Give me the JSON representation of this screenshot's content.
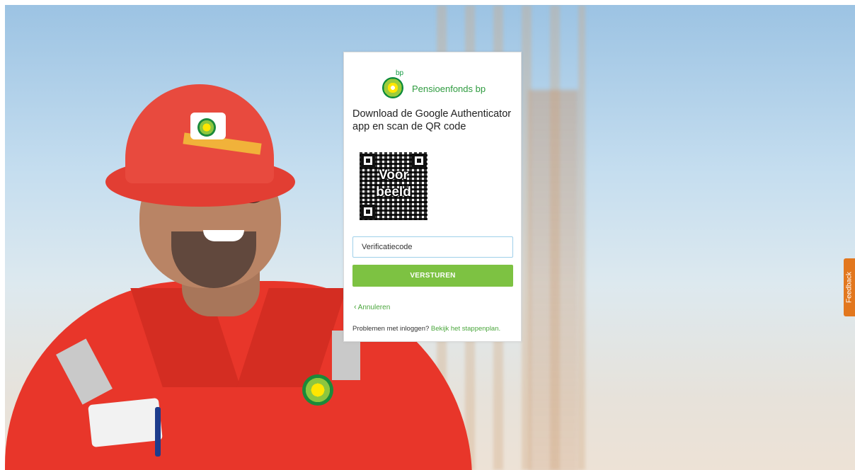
{
  "brand": {
    "superscript": "bp",
    "name": "Pensioenfonds bp",
    "logo_icon": "bp-helios-sun-icon",
    "colors": {
      "green": "#7dc242",
      "link": "#4aa63c",
      "feedback": "#e2771e"
    }
  },
  "card": {
    "heading": "Download de Google Authenticator app en scan de QR code",
    "qr": {
      "overlay_line1": "Voor",
      "overlay_line2": "beeld"
    },
    "input": {
      "placeholder": "Verificatiecode",
      "value": ""
    },
    "submit_label": "VERSTUREN",
    "cancel_label": "Annuleren",
    "help_text": "Problemen met inloggen? ",
    "help_link": "Bekijk het stappenplan."
  },
  "feedback_tab": {
    "label": "Feedback"
  }
}
